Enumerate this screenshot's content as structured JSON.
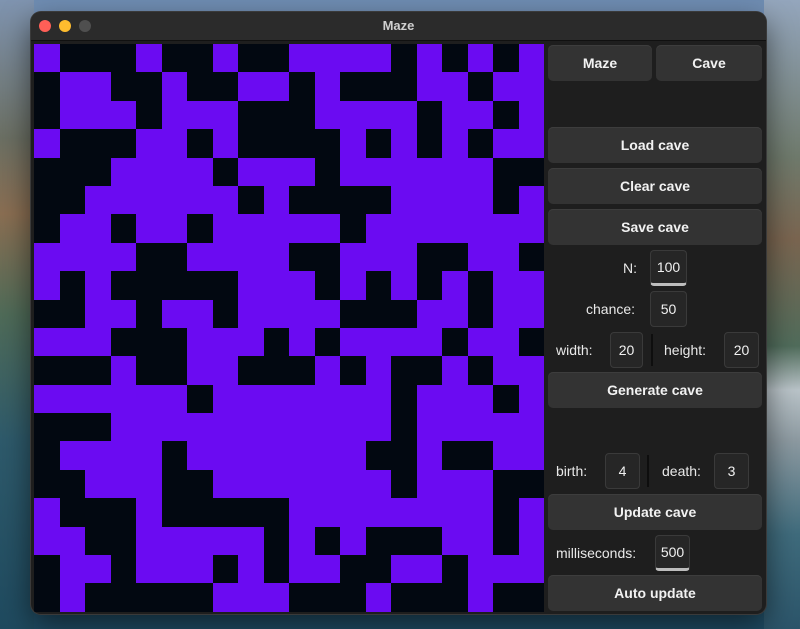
{
  "window": {
    "title": "Maze"
  },
  "controls": {
    "maze_tab": "Maze",
    "cave_tab": "Cave",
    "load": "Load cave",
    "clear": "Clear cave",
    "save": "Save cave",
    "n_label": "N:",
    "n_value": "100",
    "chance_label": "chance:",
    "chance_value": "50",
    "width_label": "width:",
    "width_value": "20",
    "height_label": "height:",
    "height_value": "20",
    "generate": "Generate cave",
    "birth_label": "birth:",
    "birth_value": "4",
    "death_label": "death:",
    "death_value": "3",
    "update": "Update cave",
    "ms_label": "milliseconds:",
    "ms_value": "500",
    "auto": "Auto update"
  },
  "cave": {
    "cols": 20,
    "rows": 20,
    "alive_color": "#6b0bf2",
    "dead_color": "#020811",
    "cells": [
      "10001001001111010101",
      "01100100110100011011",
      "01110111000111101101",
      "10001101000010101011",
      "00011110111011111100",
      "00111111010000111101",
      "01101101111101111111",
      "11110011110011100110",
      "10100000111010101011",
      "00110110111100011011",
      "11100011101011110110",
      "00010011000101001011",
      "11111101111111011101",
      "00011111111111011111",
      "01111011111110010011",
      "00111001111111011100",
      "10001000001111111101",
      "11001111101010001101",
      "01101110101100110111",
      "01000001110001000100"
    ]
  }
}
